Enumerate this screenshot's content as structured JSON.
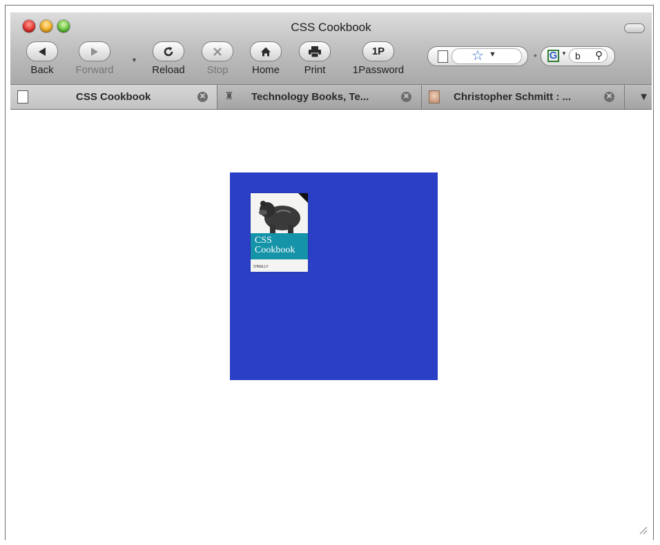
{
  "window": {
    "title": "CSS Cookbook"
  },
  "toolbar": {
    "back_label": "Back",
    "forward_label": "Forward",
    "reload_label": "Reload",
    "stop_label": "Stop",
    "home_label": "Home",
    "print_label": "Print",
    "password_label": "1Password",
    "password_icon_text": "1P"
  },
  "search": {
    "field_text": "b",
    "engine_letter": "G"
  },
  "tabs": [
    {
      "label": "CSS Cookbook",
      "active": true,
      "icon": "page-icon"
    },
    {
      "label": "Technology Books, Te...",
      "active": false,
      "icon": "robot-icon"
    },
    {
      "label": "Christopher Schmitt : ...",
      "active": false,
      "icon": "portrait-icon"
    }
  ],
  "content": {
    "box_color": "#2a3fc5",
    "book": {
      "title_line1": "CSS",
      "title_line2": "Cookbook",
      "publisher": "O'REILLY"
    }
  }
}
